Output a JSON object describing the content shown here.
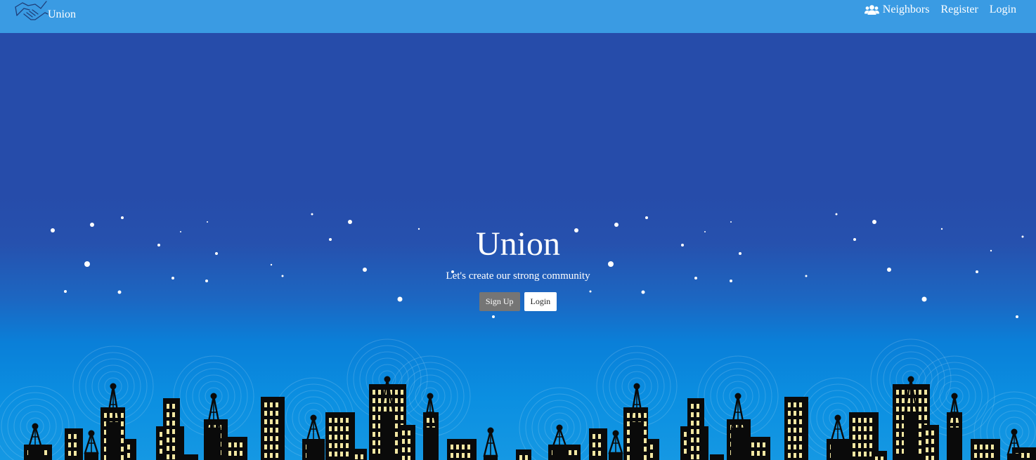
{
  "navbar": {
    "brand": "Union",
    "brand_logo": "handshake-icon",
    "links": [
      {
        "label": "Neighbors",
        "icon": "users-icon"
      },
      {
        "label": "Register"
      },
      {
        "label": "Login"
      }
    ]
  },
  "hero": {
    "title": "Union",
    "subtitle": "Let's create our strong community",
    "signup_label": "Sign Up",
    "login_label": "Login"
  },
  "colors": {
    "navbar": "#3a9be3",
    "sky_top": "#264caa",
    "sky_bottom": "#1598e3",
    "buildings": "#0a0a0a",
    "windows": "#f3e7a2",
    "signup_button": "#757575"
  }
}
